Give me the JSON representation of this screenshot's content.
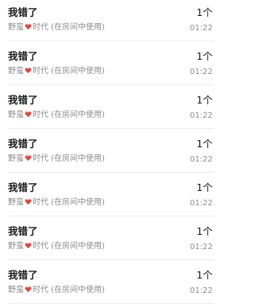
{
  "chats": [
    {
      "title": "我错了",
      "name_prefix": "野蛮",
      "name_suffix": "时代 (在房间中使用)",
      "count": "1个",
      "time": "01:22"
    },
    {
      "title": "我错了",
      "name_prefix": "野蛮",
      "name_suffix": "时代 (在房间中使用)",
      "count": "1个",
      "time": "01:22"
    },
    {
      "title": "我错了",
      "name_prefix": "野蛮",
      "name_suffix": "时代 (在房间中使用)",
      "count": "1个",
      "time": "01:22"
    },
    {
      "title": "我错了",
      "name_prefix": "野蛮",
      "name_suffix": "时代 (在房间中使用)",
      "count": "1个",
      "time": "01:22"
    },
    {
      "title": "我错了",
      "name_prefix": "野蛮",
      "name_suffix": "时代 (在房间中使用)",
      "count": "1个",
      "time": "01:22"
    },
    {
      "title": "我错了",
      "name_prefix": "野蛮",
      "name_suffix": "时代 (在房间中使用)",
      "count": "1个",
      "time": "01:22"
    },
    {
      "title": "我错了",
      "name_prefix": "野蛮",
      "name_suffix": "时代 (在房间中使用)",
      "count": "1个",
      "time": "01:22"
    }
  ],
  "icons": {
    "heart": "heart-icon"
  },
  "colors": {
    "heart_fill": "#e8433c",
    "heart_highlight": "#f5a623",
    "subtext": "#8c8c8c"
  }
}
